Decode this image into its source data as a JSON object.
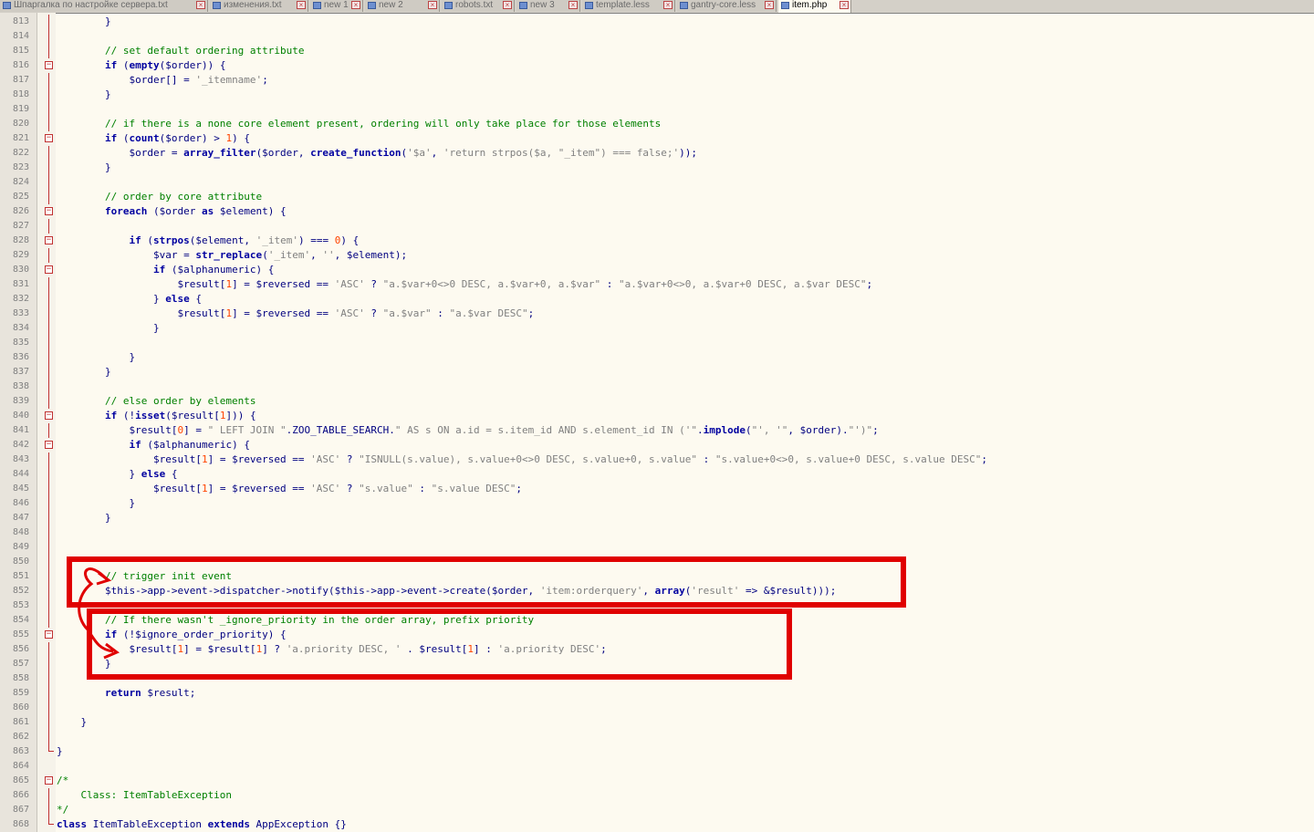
{
  "tabs": [
    {
      "label": "Шпаргалка по настройке сервера.txt",
      "active": false
    },
    {
      "label": "изменения.txt",
      "active": false
    },
    {
      "label": "new 1",
      "active": false
    },
    {
      "label": "new 2",
      "active": false
    },
    {
      "label": "robots.txt",
      "active": false
    },
    {
      "label": "new 3",
      "active": false
    },
    {
      "label": "template.less",
      "active": false
    },
    {
      "label": "gantry-core.less",
      "active": false
    },
    {
      "label": "item.php",
      "active": true
    }
  ],
  "colors": {
    "comment": "#008000",
    "keyword": "#0000a0",
    "string": "#808080",
    "number": "#ff4400",
    "plain": "#000080",
    "annotation": "#e00000"
  },
  "lines": [
    {
      "n": "813",
      "fold": "line",
      "t": [
        [
          "pl",
          "        }"
        ]
      ]
    },
    {
      "n": "814",
      "fold": "line",
      "t": []
    },
    {
      "n": "815",
      "fold": "line",
      "t": [
        [
          "com",
          "        // set default ordering attribute"
        ]
      ]
    },
    {
      "n": "816",
      "fold": "box",
      "t": [
        [
          "pl",
          "        "
        ],
        [
          "kw",
          "if"
        ],
        [
          "pl",
          " ("
        ],
        [
          "kw",
          "empty"
        ],
        [
          "pl",
          "($order)) {"
        ]
      ]
    },
    {
      "n": "817",
      "fold": "line",
      "t": [
        [
          "pl",
          "            $order[] = "
        ],
        [
          "str",
          "'_itemname'"
        ],
        [
          "pl",
          ";"
        ]
      ]
    },
    {
      "n": "818",
      "fold": "line",
      "t": [
        [
          "pl",
          "        }"
        ]
      ]
    },
    {
      "n": "819",
      "fold": "line",
      "t": []
    },
    {
      "n": "820",
      "fold": "line",
      "t": [
        [
          "com",
          "        // if there is a none core element present, ordering will only take place for those elements"
        ]
      ]
    },
    {
      "n": "821",
      "fold": "box",
      "t": [
        [
          "pl",
          "        "
        ],
        [
          "kw",
          "if"
        ],
        [
          "pl",
          " ("
        ],
        [
          "kw",
          "count"
        ],
        [
          "pl",
          "($order) > "
        ],
        [
          "num",
          "1"
        ],
        [
          "pl",
          ") {"
        ]
      ]
    },
    {
      "n": "822",
      "fold": "line",
      "t": [
        [
          "pl",
          "            $order = "
        ],
        [
          "kw",
          "array_filter"
        ],
        [
          "pl",
          "($order, "
        ],
        [
          "kw",
          "create_function"
        ],
        [
          "pl",
          "("
        ],
        [
          "str",
          "'$a'"
        ],
        [
          "pl",
          ", "
        ],
        [
          "str",
          "'return strpos($a, \"_item\") === false;'"
        ],
        [
          "pl",
          "));"
        ]
      ]
    },
    {
      "n": "823",
      "fold": "line",
      "t": [
        [
          "pl",
          "        }"
        ]
      ]
    },
    {
      "n": "824",
      "fold": "line",
      "t": []
    },
    {
      "n": "825",
      "fold": "line",
      "t": [
        [
          "com",
          "        // order by core attribute"
        ]
      ]
    },
    {
      "n": "826",
      "fold": "box",
      "t": [
        [
          "pl",
          "        "
        ],
        [
          "kw",
          "foreach"
        ],
        [
          "pl",
          " ($order "
        ],
        [
          "kw",
          "as"
        ],
        [
          "pl",
          " $element) {"
        ]
      ]
    },
    {
      "n": "827",
      "fold": "line",
      "t": []
    },
    {
      "n": "828",
      "fold": "box",
      "t": [
        [
          "pl",
          "            "
        ],
        [
          "kw",
          "if"
        ],
        [
          "pl",
          " ("
        ],
        [
          "kw",
          "strpos"
        ],
        [
          "pl",
          "($element, "
        ],
        [
          "str",
          "'_item'"
        ],
        [
          "pl",
          ") === "
        ],
        [
          "num",
          "0"
        ],
        [
          "pl",
          ") {"
        ]
      ]
    },
    {
      "n": "829",
      "fold": "line",
      "t": [
        [
          "pl",
          "                $var = "
        ],
        [
          "kw",
          "str_replace"
        ],
        [
          "pl",
          "("
        ],
        [
          "str",
          "'_item'"
        ],
        [
          "pl",
          ", "
        ],
        [
          "str",
          "''"
        ],
        [
          "pl",
          ", $element);"
        ]
      ]
    },
    {
      "n": "830",
      "fold": "box",
      "t": [
        [
          "pl",
          "                "
        ],
        [
          "kw",
          "if"
        ],
        [
          "pl",
          " ($alphanumeric) {"
        ]
      ]
    },
    {
      "n": "831",
      "fold": "line",
      "t": [
        [
          "pl",
          "                    $result["
        ],
        [
          "num",
          "1"
        ],
        [
          "pl",
          "] = $reversed == "
        ],
        [
          "str",
          "'ASC'"
        ],
        [
          "pl",
          " ? "
        ],
        [
          "str",
          "\"a.$var+0<>0 DESC, a.$var+0, a.$var\""
        ],
        [
          "pl",
          " : "
        ],
        [
          "str",
          "\"a.$var+0<>0, a.$var+0 DESC, a.$var DESC\""
        ],
        [
          "pl",
          ";"
        ]
      ]
    },
    {
      "n": "832",
      "fold": "line",
      "t": [
        [
          "pl",
          "                } "
        ],
        [
          "kw",
          "else"
        ],
        [
          "pl",
          " {"
        ]
      ]
    },
    {
      "n": "833",
      "fold": "line",
      "t": [
        [
          "pl",
          "                    $result["
        ],
        [
          "num",
          "1"
        ],
        [
          "pl",
          "] = $reversed == "
        ],
        [
          "str",
          "'ASC'"
        ],
        [
          "pl",
          " ? "
        ],
        [
          "str",
          "\"a.$var\""
        ],
        [
          "pl",
          " : "
        ],
        [
          "str",
          "\"a.$var DESC\""
        ],
        [
          "pl",
          ";"
        ]
      ]
    },
    {
      "n": "834",
      "fold": "line",
      "t": [
        [
          "pl",
          "                }"
        ]
      ]
    },
    {
      "n": "835",
      "fold": "line",
      "t": []
    },
    {
      "n": "836",
      "fold": "line",
      "t": [
        [
          "pl",
          "            }"
        ]
      ]
    },
    {
      "n": "837",
      "fold": "line",
      "t": [
        [
          "pl",
          "        }"
        ]
      ]
    },
    {
      "n": "838",
      "fold": "line",
      "t": []
    },
    {
      "n": "839",
      "fold": "line",
      "t": [
        [
          "com",
          "        // else order by elements"
        ]
      ]
    },
    {
      "n": "840",
      "fold": "box",
      "t": [
        [
          "pl",
          "        "
        ],
        [
          "kw",
          "if"
        ],
        [
          "pl",
          " (!"
        ],
        [
          "kw",
          "isset"
        ],
        [
          "pl",
          "($result["
        ],
        [
          "num",
          "1"
        ],
        [
          "pl",
          "])) {"
        ]
      ]
    },
    {
      "n": "841",
      "fold": "line",
      "t": [
        [
          "pl",
          "            $result["
        ],
        [
          "num",
          "0"
        ],
        [
          "pl",
          "] = "
        ],
        [
          "str",
          "\" LEFT JOIN \""
        ],
        [
          "pl",
          ".ZOO_TABLE_SEARCH."
        ],
        [
          "str",
          "\" AS s ON a.id = s.item_id AND s.element_id IN ('\""
        ],
        [
          "pl",
          "."
        ],
        [
          "kw",
          "implode"
        ],
        [
          "pl",
          "("
        ],
        [
          "str",
          "\"', '\""
        ],
        [
          "pl",
          ", $order)."
        ],
        [
          "str",
          "\"')\""
        ],
        [
          "pl",
          ";"
        ]
      ]
    },
    {
      "n": "842",
      "fold": "box",
      "t": [
        [
          "pl",
          "            "
        ],
        [
          "kw",
          "if"
        ],
        [
          "pl",
          " ($alphanumeric) {"
        ]
      ]
    },
    {
      "n": "843",
      "fold": "line",
      "t": [
        [
          "pl",
          "                $result["
        ],
        [
          "num",
          "1"
        ],
        [
          "pl",
          "] = $reversed == "
        ],
        [
          "str",
          "'ASC'"
        ],
        [
          "pl",
          " ? "
        ],
        [
          "str",
          "\"ISNULL(s.value), s.value+0<>0 DESC, s.value+0, s.value\""
        ],
        [
          "pl",
          " : "
        ],
        [
          "str",
          "\"s.value+0<>0, s.value+0 DESC, s.value DESC\""
        ],
        [
          "pl",
          ";"
        ]
      ]
    },
    {
      "n": "844",
      "fold": "line",
      "t": [
        [
          "pl",
          "            } "
        ],
        [
          "kw",
          "else"
        ],
        [
          "pl",
          " {"
        ]
      ]
    },
    {
      "n": "845",
      "fold": "line",
      "t": [
        [
          "pl",
          "                $result["
        ],
        [
          "num",
          "1"
        ],
        [
          "pl",
          "] = $reversed == "
        ],
        [
          "str",
          "'ASC'"
        ],
        [
          "pl",
          " ? "
        ],
        [
          "str",
          "\"s.value\""
        ],
        [
          "pl",
          " : "
        ],
        [
          "str",
          "\"s.value DESC\""
        ],
        [
          "pl",
          ";"
        ]
      ]
    },
    {
      "n": "846",
      "fold": "line",
      "t": [
        [
          "pl",
          "            }"
        ]
      ]
    },
    {
      "n": "847",
      "fold": "line",
      "t": [
        [
          "pl",
          "        }"
        ]
      ]
    },
    {
      "n": "848",
      "fold": "line",
      "t": []
    },
    {
      "n": "849",
      "fold": "line",
      "t": []
    },
    {
      "n": "850",
      "fold": "line",
      "t": []
    },
    {
      "n": "851",
      "fold": "line",
      "t": [
        [
          "com",
          "        // trigger init event"
        ]
      ]
    },
    {
      "n": "852",
      "fold": "line",
      "t": [
        [
          "pl",
          "        $this->app->event->dispatcher->notify($this->app->event->create($order, "
        ],
        [
          "str",
          "'item:orderquery'"
        ],
        [
          "pl",
          ", "
        ],
        [
          "kw",
          "array"
        ],
        [
          "pl",
          "("
        ],
        [
          "str",
          "'result'"
        ],
        [
          "pl",
          " => &$result)));"
        ]
      ]
    },
    {
      "n": "853",
      "fold": "line",
      "t": []
    },
    {
      "n": "854",
      "fold": "line",
      "t": [
        [
          "com",
          "        // If there wasn't _ignore_priority in the order array, prefix priority"
        ]
      ]
    },
    {
      "n": "855",
      "fold": "box",
      "t": [
        [
          "pl",
          "        "
        ],
        [
          "kw",
          "if"
        ],
        [
          "pl",
          " (!$ignore_order_priority) {"
        ]
      ]
    },
    {
      "n": "856",
      "fold": "line",
      "t": [
        [
          "pl",
          "            $result["
        ],
        [
          "num",
          "1"
        ],
        [
          "pl",
          "] = $result["
        ],
        [
          "num",
          "1"
        ],
        [
          "pl",
          "] ? "
        ],
        [
          "str",
          "'a.priority DESC, '"
        ],
        [
          "pl",
          " . $result["
        ],
        [
          "num",
          "1"
        ],
        [
          "pl",
          "] : "
        ],
        [
          "str",
          "'a.priority DESC'"
        ],
        [
          "pl",
          ";"
        ]
      ]
    },
    {
      "n": "857",
      "fold": "line",
      "t": [
        [
          "pl",
          "        }"
        ]
      ]
    },
    {
      "n": "858",
      "fold": "line",
      "t": []
    },
    {
      "n": "859",
      "fold": "line",
      "t": [
        [
          "pl",
          "        "
        ],
        [
          "kw",
          "return"
        ],
        [
          "pl",
          " $result;"
        ]
      ]
    },
    {
      "n": "860",
      "fold": "line",
      "t": []
    },
    {
      "n": "861",
      "fold": "line",
      "t": [
        [
          "pl",
          "    }"
        ]
      ]
    },
    {
      "n": "862",
      "fold": "line",
      "t": []
    },
    {
      "n": "863",
      "fold": "end",
      "t": [
        [
          "pl",
          "}"
        ]
      ]
    },
    {
      "n": "864",
      "fold": "none",
      "t": []
    },
    {
      "n": "865",
      "fold": "box",
      "t": [
        [
          "com",
          "/*"
        ]
      ]
    },
    {
      "n": "866",
      "fold": "line",
      "t": [
        [
          "com",
          "    Class: ItemTableException"
        ]
      ]
    },
    {
      "n": "867",
      "fold": "line",
      "t": [
        [
          "com",
          "*/"
        ]
      ]
    },
    {
      "n": "868",
      "fold": "end",
      "t": [
        [
          "kw",
          "class"
        ],
        [
          "pl",
          " ItemTableException "
        ],
        [
          "kw",
          "extends"
        ],
        [
          "pl",
          " AppException {}"
        ]
      ]
    }
  ]
}
